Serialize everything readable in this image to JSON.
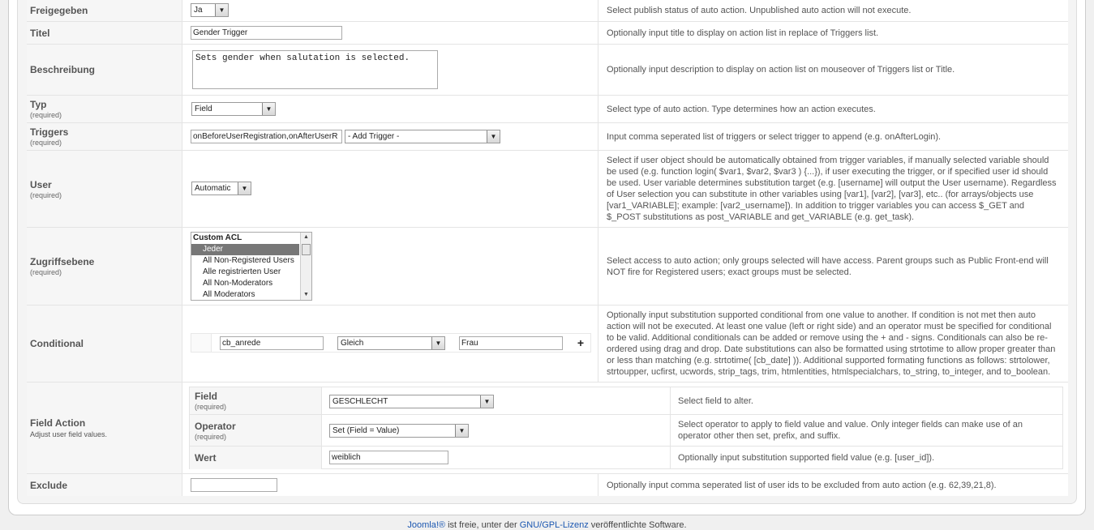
{
  "rows": {
    "published": {
      "label": "Freigegeben",
      "value": "Ja",
      "desc": "Select publish status of auto action. Unpublished auto action will not execute."
    },
    "title": {
      "label": "Titel",
      "value": "Gender Trigger",
      "desc": "Optionally input title to display on action list in replace of Triggers list."
    },
    "description": {
      "label": "Beschreibung",
      "value": "Sets gender when salutation is selected.",
      "desc": "Optionally input description to display on action list on mouseover of Triggers list or Title."
    },
    "type": {
      "label": "Typ",
      "required": "(required)",
      "value": "Field",
      "desc": "Select type of auto action. Type determines how an action executes."
    },
    "triggers": {
      "label": "Triggers",
      "required": "(required)",
      "value": "onBeforeUserRegistration,onAfterUserR",
      "select": "- Add Trigger -",
      "desc": "Input comma seperated list of triggers or select trigger to append (e.g. onAfterLogin)."
    },
    "user": {
      "label": "User",
      "required": "(required)",
      "value": "Automatic",
      "desc": "Select if user object should be automatically obtained from trigger variables, if manually selected variable should be used (e.g. function login( $var1, $var2, $var3 ) {...}), if user executing the trigger, or if specified user id should be used. User variable determines substitution target (e.g. [username] will output the User username). Regardless of User selection you can substitute in other variables using [var1], [var2], [var3], etc.. (for arrays/objects use [var1_VARIABLE]; example: [var2_username]). In addition to trigger variables you can access $_GET and $_POST substitutions as post_VARIABLE and get_VARIABLE (e.g. get_task)."
    },
    "access": {
      "label": "Zugriffsebene",
      "required": "(required)",
      "options": [
        "Custom ACL",
        "Jeder",
        "All Non-Registered Users",
        "Alle registrierten User",
        "All Non-Moderators",
        "All Moderators"
      ],
      "desc": "Select access to auto action; only groups selected will have access. Parent groups such as Public Front-end will NOT fire for Registered users; exact groups must be selected."
    },
    "conditional": {
      "label": "Conditional",
      "left": "cb_anrede",
      "operator": "Gleich",
      "right": "Frau",
      "add": "+",
      "desc": "Optionally input substitution supported conditional from one value to another. If condition is not met then auto action will not be executed. At least one value (left or right side) and an operator must be specified for conditional to be valid. Additional conditionals can be added or remove using the + and - signs. Conditionals can also be re-ordered using drag and drop. Date substitutions can also be formatted using strtotime to allow proper greater than or less than matching (e.g. strtotime( [cb_date] )). Additional supported formating functions as follows: strtolower, strtoupper, ucfirst, ucwords, strip_tags, trim, htmlentities, htmlspecialchars, to_string, to_integer, and to_boolean."
    },
    "field_action": {
      "label": "Field Action",
      "sub": "Adjust user field values.",
      "field": {
        "label": "Field",
        "required": "(required)",
        "value": "GESCHLECHT",
        "desc": "Select field to alter."
      },
      "operator": {
        "label": "Operator",
        "required": "(required)",
        "value": "Set (Field = Value)",
        "desc": "Select operator to apply to field value and value. Only integer fields can make use of an operator other then set, prefix, and suffix."
      },
      "value": {
        "label": "Wert",
        "value": "weiblich",
        "desc": "Optionally input substitution supported field value (e.g. [user_id])."
      }
    },
    "exclude": {
      "label": "Exclude",
      "value": "",
      "desc": "Optionally input comma seperated list of user ids to be excluded from auto action (e.g. 62,39,21,8)."
    }
  },
  "footer": {
    "joomla": "Joomla!®",
    "mid": " ist freie, unter der ",
    "license": "GNU/GPL-Lizenz",
    "end": " veröffentlichte Software."
  }
}
